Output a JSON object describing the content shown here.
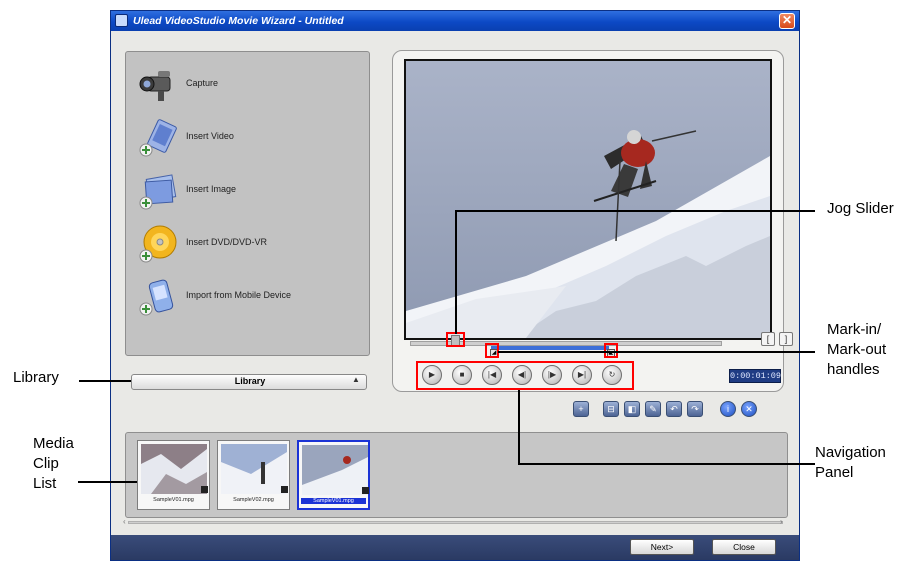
{
  "window": {
    "title": "Ulead VideoStudio Movie Wizard - Untitled",
    "close_symbol": "✕"
  },
  "menu": {
    "items": [
      {
        "label": "Capture",
        "icon": "camcorder-icon"
      },
      {
        "label": "Insert Video",
        "icon": "insert-video-icon"
      },
      {
        "label": "Insert Image",
        "icon": "insert-image-icon"
      },
      {
        "label": "Insert DVD/DVD-VR",
        "icon": "dvd-disc-icon"
      },
      {
        "label": "Import from Mobile Device",
        "icon": "mobile-device-icon"
      }
    ]
  },
  "library": {
    "label": "Library",
    "arrow": "▲"
  },
  "preview": {
    "timecode": "0:00:01:09",
    "bracket_left": "[",
    "bracket_right": "]",
    "nav_buttons": [
      {
        "name": "play",
        "glyph": "▶"
      },
      {
        "name": "stop",
        "glyph": "■"
      },
      {
        "name": "home",
        "glyph": "|◀"
      },
      {
        "name": "previous-frame",
        "glyph": "◀|"
      },
      {
        "name": "next-frame",
        "glyph": "|▶"
      },
      {
        "name": "end",
        "glyph": "▶|"
      },
      {
        "name": "repeat",
        "glyph": "↻"
      }
    ],
    "mark_in_glyph": "◢",
    "mark_out_glyph": "◣"
  },
  "toolbar": {
    "icons": [
      "add-clip-icon",
      "split-clip-icon",
      "delete-clip-icon",
      "edit-clip-icon",
      "undo-icon",
      "redo-icon",
      "info-icon",
      "close-icon"
    ],
    "glyphs": [
      "+",
      "⊟",
      "◧",
      "✎",
      "↶",
      "↷",
      "i",
      "✕"
    ]
  },
  "clips": [
    {
      "name": "SampleV01.mpg",
      "selected": false
    },
    {
      "name": "SampleV02.mpg",
      "selected": false
    },
    {
      "name": "SampleV01.mpg",
      "selected": true
    }
  ],
  "footer": {
    "next_label": "Next>",
    "close_label": "Close"
  },
  "annotations": {
    "jog_slider": "Jog Slider",
    "mark_handles": [
      "Mark-in/",
      "Mark-out",
      "handles"
    ],
    "library": "Library",
    "media_clip_list": [
      "Media",
      "Clip",
      "List"
    ],
    "navigation_panel": [
      "Navigation",
      "Panel"
    ]
  }
}
